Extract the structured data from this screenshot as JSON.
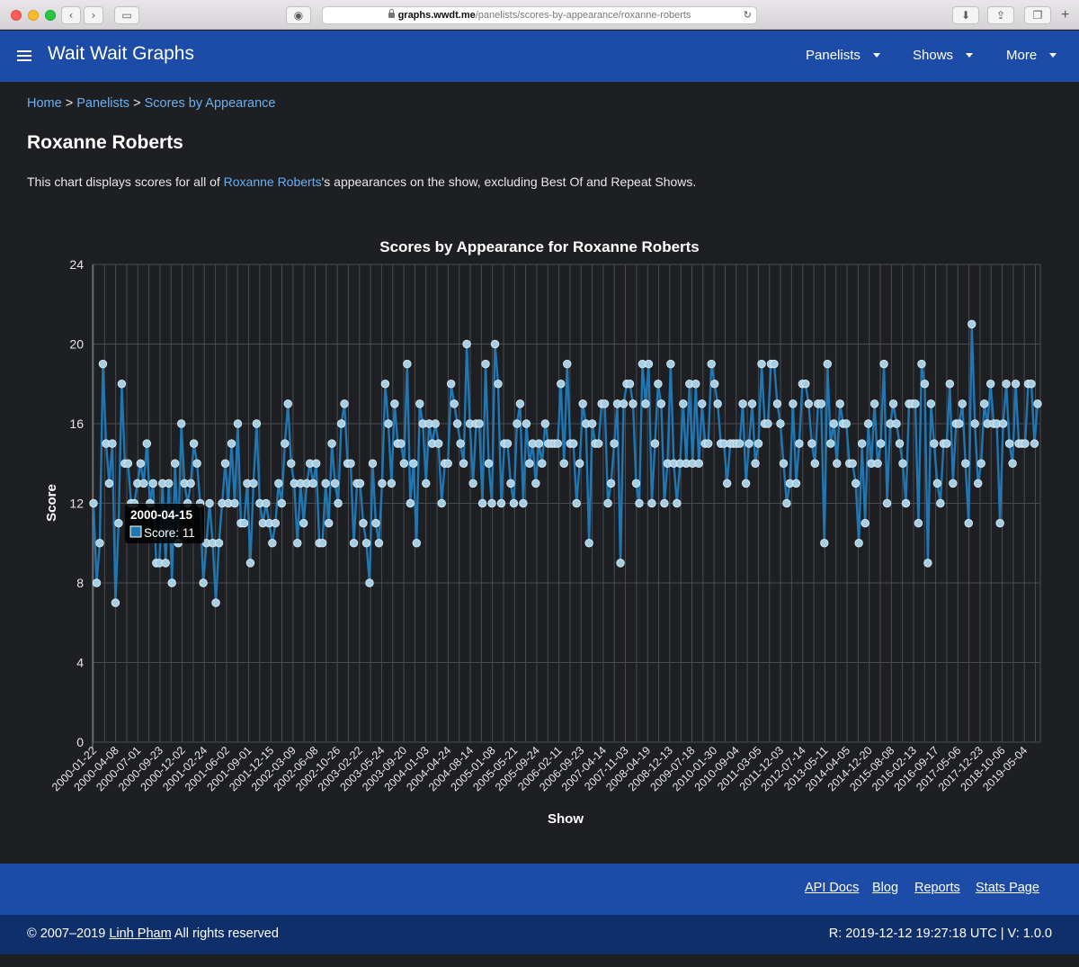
{
  "browser": {
    "url_host": "graphs.wwdt.me",
    "url_path": "/panelists/scores-by-appearance/roxanne-roberts"
  },
  "nav": {
    "brand": "Wait Wait Graphs",
    "items": [
      "Panelists",
      "Shows",
      "More"
    ]
  },
  "breadcrumb": [
    "Home",
    "Panelists",
    "Scores by Appearance"
  ],
  "page": {
    "title": "Roxanne Roberts",
    "desc_before": "This chart displays scores for all of ",
    "desc_link": "Roxanne Roberts",
    "desc_after": "'s appearances on the show, excluding Best Of and Repeat Shows."
  },
  "footer": {
    "links": [
      "API Docs",
      "Blog",
      "Reports",
      "Stats Page"
    ],
    "copyright": "© 2007–2019 ",
    "author": "Linh Pham",
    "rights": " All rights reserved",
    "build": "R: 2019-12-12 19:27:18 UTC | V: 1.0.0"
  },
  "colors": {
    "line": "#1f77b4",
    "marker_fill": "#a6cee3",
    "grid": "#4a4c52",
    "navbar": "#1c4ba8"
  },
  "chart_data": {
    "type": "line",
    "title": "Scores by Appearance for Roxanne Roberts",
    "xlabel": "Show",
    "ylabel": "Score",
    "ylim": [
      0,
      24
    ],
    "yticks": [
      0,
      4,
      8,
      12,
      16,
      20,
      24
    ],
    "grid": true,
    "xtick_labels": [
      "2000-01-22",
      "2000-04-08",
      "2000-07-01",
      "2000-09-23",
      "2000-12-02",
      "2001-02-24",
      "2001-06-02",
      "2001-09-01",
      "2001-12-15",
      "2002-03-09",
      "2002-06-08",
      "2002-10-26",
      "2003-02-22",
      "2003-05-24",
      "2003-09-20",
      "2004-01-03",
      "2004-04-24",
      "2004-08-14",
      "2005-01-08",
      "2005-05-21",
      "2005-09-24",
      "2006-02-11",
      "2006-09-23",
      "2007-04-14",
      "2007-11-03",
      "2008-04-19",
      "2008-12-13",
      "2009-07-18",
      "2010-01-30",
      "2010-09-04",
      "2011-03-05",
      "2011-12-03",
      "2012-07-14",
      "2013-05-11",
      "2014-04-05",
      "2014-12-20",
      "2015-08-08",
      "2016-02-13",
      "2016-09-17",
      "2017-05-06",
      "2017-12-23",
      "2018-10-06",
      "2019-05-04"
    ],
    "tooltip": {
      "x": "2000-04-15",
      "label": "Score: 11"
    },
    "series": [
      {
        "name": "Score",
        "values": [
          12,
          8,
          10,
          19,
          15,
          13,
          15,
          7,
          11,
          18,
          14,
          14,
          12,
          12,
          13,
          14,
          13,
          15,
          12,
          13,
          9,
          9,
          13,
          9,
          13,
          8,
          14,
          10,
          16,
          13,
          12,
          13,
          15,
          14,
          12,
          8,
          10,
          12,
          10,
          7,
          10,
          12,
          14,
          12,
          15,
          12,
          16,
          11,
          11,
          13,
          9,
          13,
          16,
          12,
          11,
          12,
          11,
          10,
          11,
          13,
          12,
          15,
          17,
          14,
          13,
          10,
          13,
          11,
          13,
          14,
          13,
          14,
          10,
          10,
          13,
          11,
          15,
          13,
          12,
          16,
          17,
          14,
          14,
          10,
          13,
          13,
          11,
          10,
          8,
          14,
          11,
          10,
          13,
          18,
          16,
          13,
          17,
          15,
          15,
          14,
          19,
          12,
          14,
          10,
          17,
          16,
          13,
          16,
          15,
          16,
          15,
          12,
          14,
          14,
          18,
          17,
          16,
          15,
          14,
          20,
          16,
          13,
          16,
          16,
          12,
          19,
          14,
          12,
          20,
          18,
          12,
          15,
          15,
          13,
          12,
          16,
          17,
          12,
          16,
          14,
          15,
          13,
          15,
          14,
          16,
          15,
          15,
          15,
          15,
          18,
          14,
          19,
          15,
          15,
          12,
          14,
          17,
          16,
          10,
          16,
          15,
          15,
          17,
          17,
          12,
          13,
          15,
          17,
          9,
          17,
          18,
          18,
          17,
          13,
          12,
          19,
          17,
          19,
          12,
          15,
          18,
          17,
          12,
          14,
          19,
          14,
          12,
          14,
          17,
          14,
          18,
          14,
          18,
          14,
          17,
          15,
          15,
          19,
          18,
          17,
          15,
          15,
          13,
          15,
          15,
          15,
          15,
          17,
          13,
          15,
          17,
          14,
          15,
          19,
          16,
          16,
          19,
          19,
          17,
          16,
          14,
          12,
          13,
          17,
          13,
          15,
          18,
          18,
          17,
          15,
          14,
          17,
          17,
          10,
          19,
          15,
          16,
          14,
          17,
          16,
          16,
          14,
          14,
          13,
          10,
          15,
          11,
          16,
          14,
          17,
          14,
          15,
          19,
          12,
          16,
          17,
          16,
          15,
          14,
          12,
          17,
          17,
          17,
          11,
          19,
          18,
          9,
          17,
          15,
          13,
          12,
          15,
          15,
          18,
          13,
          16,
          16,
          17,
          14,
          11,
          21,
          16,
          13,
          14,
          17,
          16,
          18,
          16,
          16,
          11,
          16,
          18,
          15,
          14,
          18,
          15,
          15,
          15,
          18,
          18,
          15,
          17
        ]
      }
    ]
  }
}
